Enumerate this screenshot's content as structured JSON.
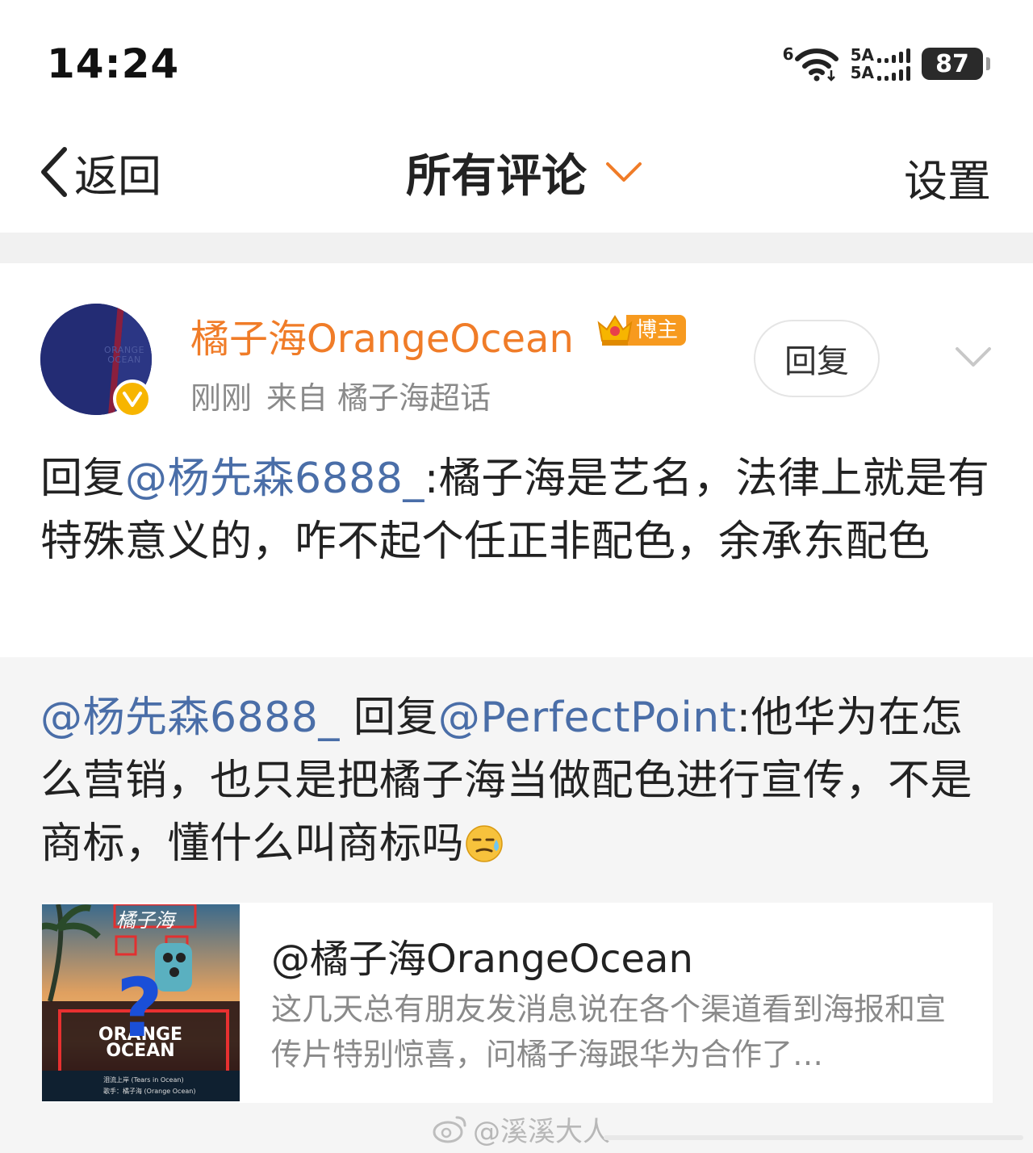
{
  "status_bar": {
    "time": "14:24",
    "network_type": "6",
    "sim1_label": "5A",
    "sim2_label": "5A",
    "battery": "87"
  },
  "nav": {
    "back_label": "返回",
    "title": "所有评论",
    "settings_label": "设置"
  },
  "comment": {
    "author": "橘子海OrangeOcean",
    "avatar_text": "ORANGE OCEAN",
    "role_badge": "博主",
    "time": "刚刚",
    "source": "来自 橘子海超话",
    "reply_button": "回复",
    "text_prefix": "回复",
    "text_mention": "@杨先森6888_",
    "text_body": ":橘子海是艺名，法律上就是有特殊意义的，咋不起个任正非配色，余承东配色"
  },
  "quoted": {
    "author_mention": "@杨先森6888_",
    "reply_word": " 回复",
    "target_mention": "@PerfectPoint",
    "body": ":他华为在怎么营销，也只是把橘子海当做配色进行宣传，不是商标，懂什么叫商标吗",
    "emoji": "sweat-face-emoji",
    "card": {
      "title": "@橘子海OrangeOcean",
      "description": "这几天总有朋友发消息说在各个渠道看到海报和宣传片特别惊喜，问橘子海跟华为合作了…",
      "thumb_text_top": "橘子海",
      "thumb_text_main": "ORANGE OCEAN",
      "thumb_text_sub": "泪流上岸 (Tears in Ocean)",
      "thumb_text_artist": "歌手：橘子海 (Orange Ocean)",
      "thumb_question": "?"
    }
  },
  "watermark": "@溪溪大人",
  "colors": {
    "accent_orange": "#f07c28",
    "mention_blue": "#4a6ea8",
    "verify_gold": "#f7b500",
    "meta_gray": "#8a8a8a"
  }
}
